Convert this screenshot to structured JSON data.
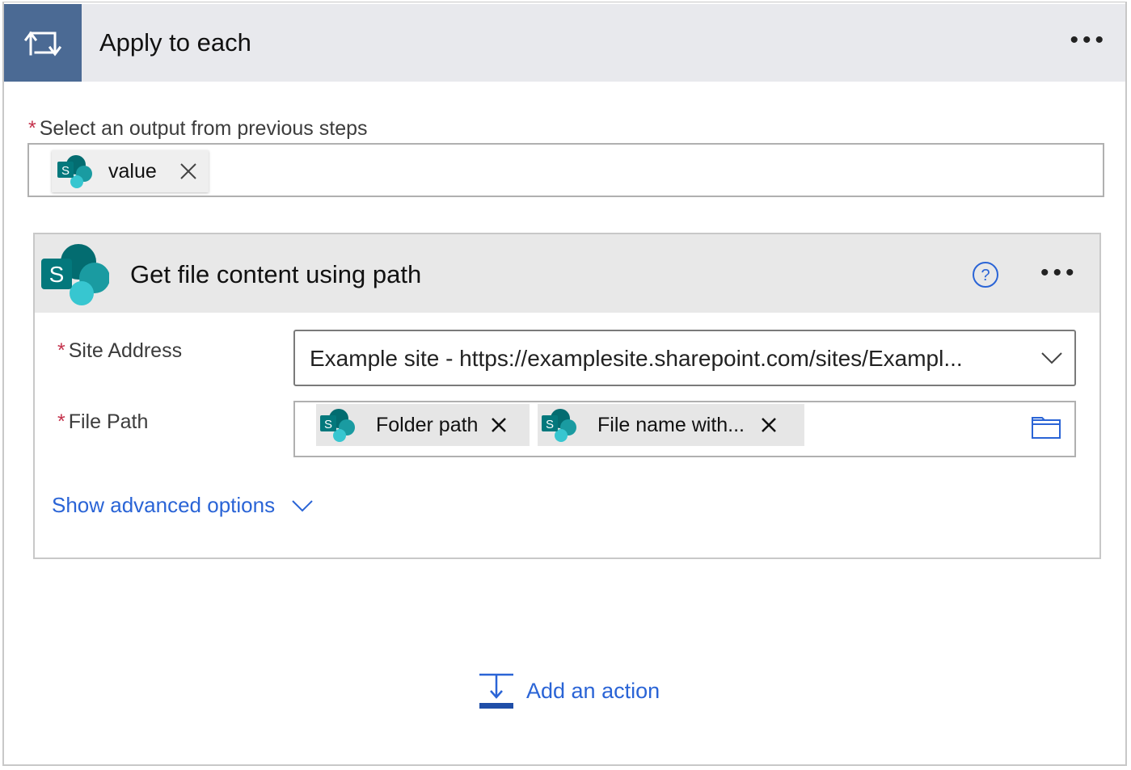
{
  "loop": {
    "title": "Apply to each",
    "icon": "loop-icon",
    "more_label": "•••",
    "output_field": {
      "required_mark": "*",
      "label": "Select an output from previous steps",
      "token_label": "value",
      "token_icon": "sharepoint-icon"
    }
  },
  "action": {
    "title": "Get file content using path",
    "icon": "sharepoint-icon",
    "help_icon": "help-icon",
    "more_label": "•••",
    "site_address": {
      "required_mark": "*",
      "label": "Site Address",
      "value": "Example site - https://examplesite.sharepoint.com/sites/Exampl..."
    },
    "file_path": {
      "required_mark": "*",
      "label": "File Path",
      "tokens": [
        {
          "label": "Folder path"
        },
        {
          "label": "File name with..."
        }
      ]
    },
    "advanced_label": "Show advanced options"
  },
  "add_action_label": "Add an action",
  "colors": {
    "header_icon_bg": "#4b6a94",
    "accent_link": "#2a64d6",
    "required": "#c4314b",
    "sharepoint_dark": "#036c70",
    "sharepoint_mid": "#1a9ba1",
    "sharepoint_light": "#37c6d0"
  }
}
